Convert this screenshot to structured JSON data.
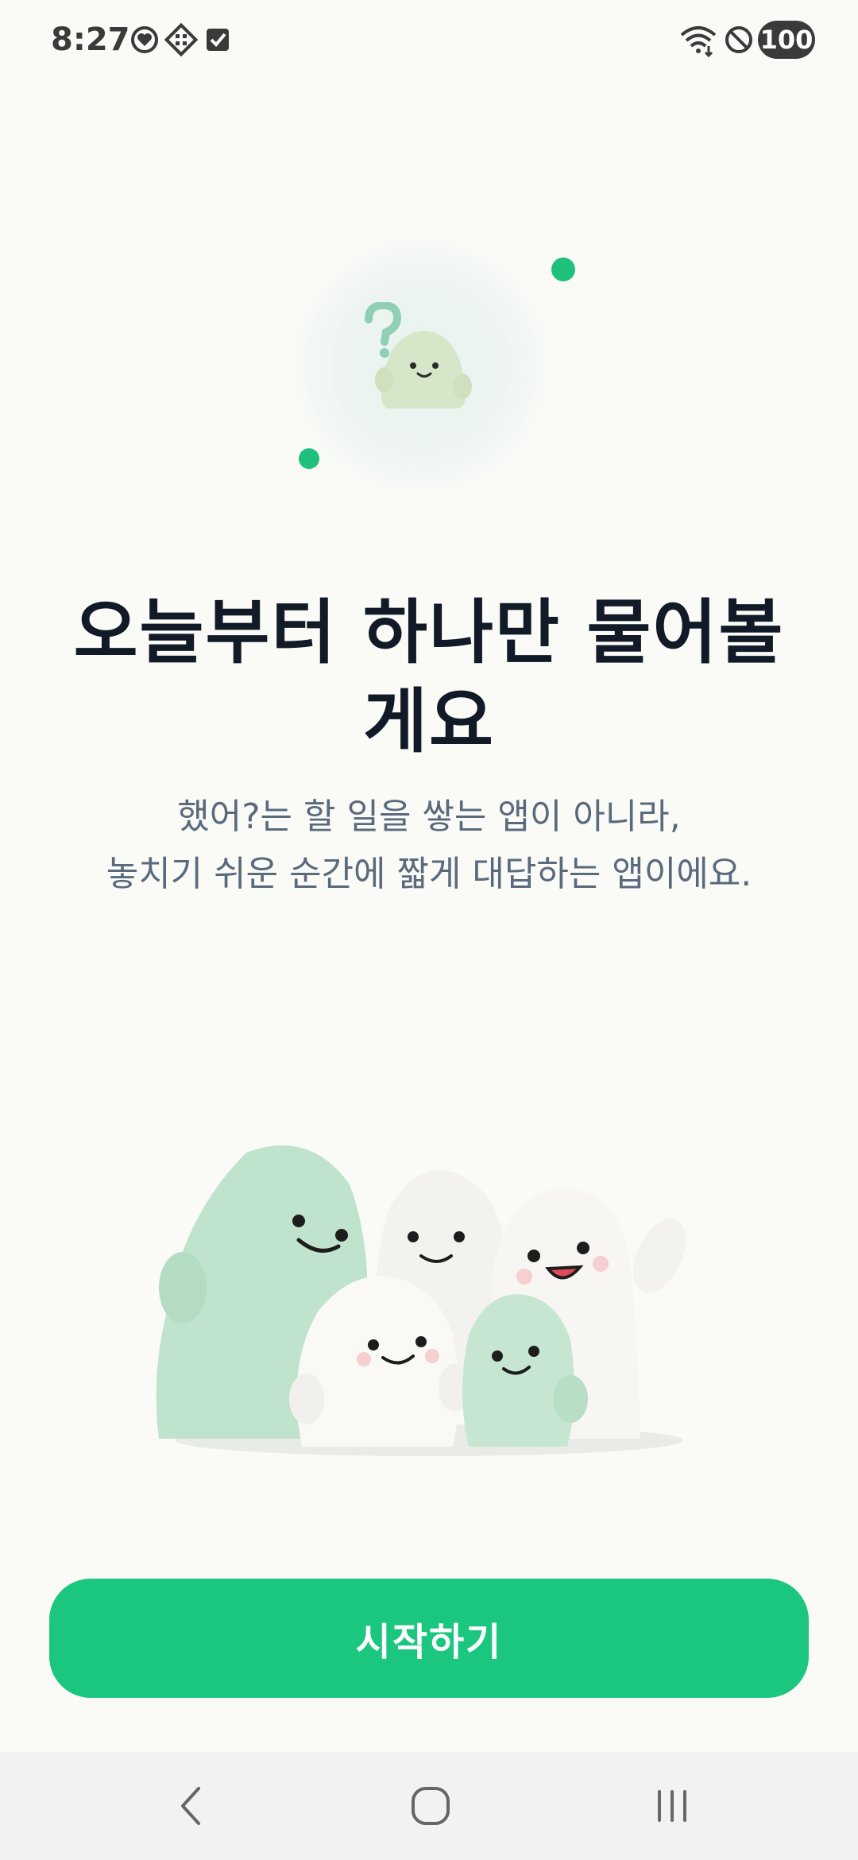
{
  "status_bar": {
    "time": "8:27",
    "battery": "100",
    "icons": [
      "heart-shield-icon",
      "diamond-grid-icon",
      "check-square-icon",
      "wifi-icon",
      "do-not-disturb-icon"
    ]
  },
  "onboarding": {
    "title_line1": "오늘부터 하나만 물어볼",
    "title_line2": "게요",
    "subtitle_line1": "했어?는 할 일을 쌓는 앱이 아니라,",
    "subtitle_line2": "놓치기 쉬운 순간에 짧게 대답하는 앱이에요.",
    "start_button": "시작하기"
  },
  "colors": {
    "accent": "#1bc67e",
    "title": "#111a26",
    "subtitle": "#5a6a7d",
    "background": "#fafbf7"
  },
  "navbar": {
    "icons": [
      "back-icon",
      "home-icon",
      "recents-icon"
    ]
  }
}
